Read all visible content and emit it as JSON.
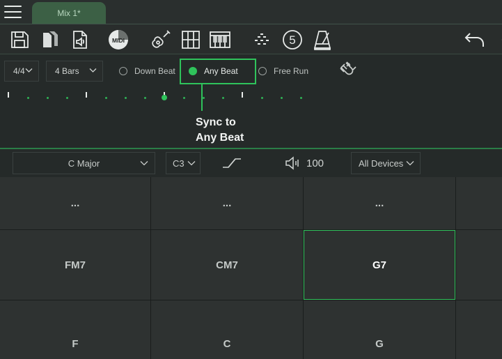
{
  "app": {
    "menu_icon": "hamburger-menu-icon",
    "tab_label": "Mix 1*"
  },
  "toolbar": {
    "icons": [
      "save-icon",
      "open-file-icon",
      "audio-file-icon",
      "midi-icon",
      "guitar-icon",
      "grid-icon",
      "piano-icon",
      "arpeggio-dots-icon",
      "count-in-5-icon",
      "metronome-icon",
      "undo-icon"
    ],
    "midi_label": "MIDI",
    "count_label": "5"
  },
  "sync": {
    "time_signature": "4/4",
    "bars": "4 Bars",
    "options": [
      {
        "label": "Down Beat",
        "selected": false
      },
      {
        "label": "Any Beat",
        "selected": true
      },
      {
        "label": "Free Run",
        "selected": false
      }
    ],
    "magnet_icon": "magnet-icon",
    "callout_line1": "Sync to",
    "callout_line2": "Any Beat"
  },
  "controls": {
    "key": "C Major",
    "octave": "C3",
    "curve_icon": "velocity-curve-icon",
    "volume_icon": "speaker-icon",
    "volume": "100",
    "device": "All Devices"
  },
  "pads": {
    "row1": [
      "...",
      "...",
      "..."
    ],
    "row2": [
      "FM7",
      "CM7",
      "G7"
    ],
    "row3": [
      "F",
      "C",
      "G"
    ],
    "active": "G7"
  },
  "colors": {
    "accent": "#2fc35b",
    "tab": "#3c6045",
    "background": "#2a2e2d",
    "pad": "#2e3231"
  }
}
